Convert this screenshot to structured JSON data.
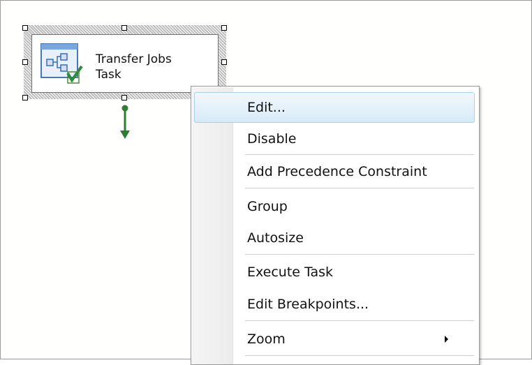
{
  "task": {
    "label_line1": "Transfer Jobs",
    "label_line2": "Task",
    "icon": "transfer-jobs-task-icon"
  },
  "context_menu": {
    "items": [
      {
        "label": "Edit..."
      },
      {
        "label": "Disable"
      },
      {
        "label": "Add Precedence Constraint"
      },
      {
        "label": "Group"
      },
      {
        "label": "Autosize"
      },
      {
        "label": "Execute Task"
      },
      {
        "label": "Edit Breakpoints..."
      },
      {
        "label": "Zoom",
        "has_submenu": true
      }
    ],
    "highlighted": "Edit..."
  },
  "colors": {
    "highlight_border": "#a8d1ef",
    "connector": "#2e7d32"
  }
}
